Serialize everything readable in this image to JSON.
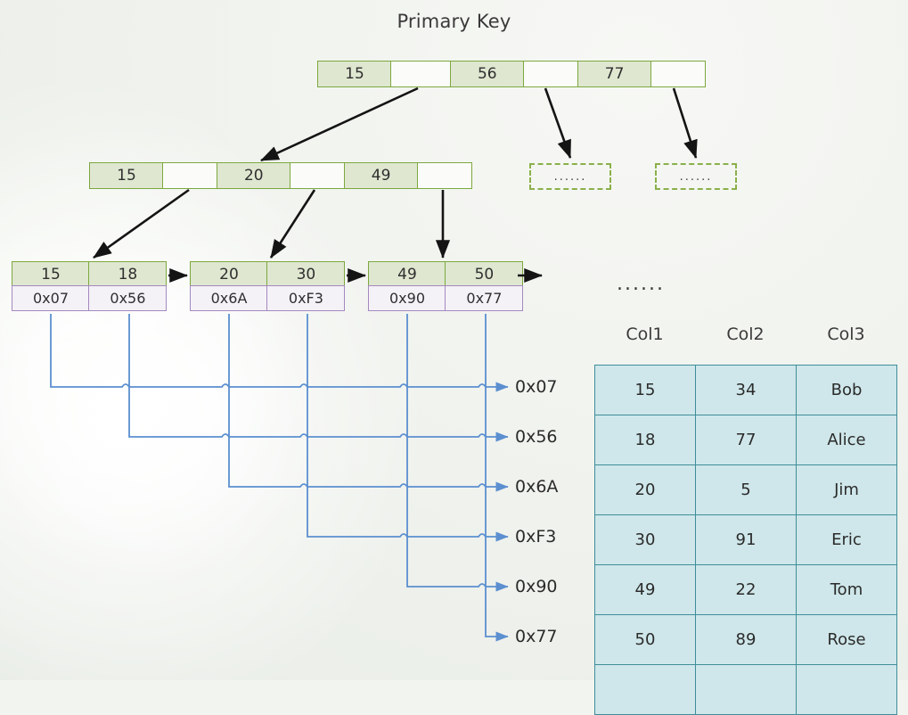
{
  "title": "Primary Key",
  "colors": {
    "node_fill": "#dfe7d0",
    "node_border": "#7ca83f",
    "pointer_fill": "#f4f1f7",
    "pointer_border": "#a489bf",
    "table_fill": "#cfe7ea",
    "table_border": "#3f8d99",
    "connector_blue": "#5b8fd0",
    "arrow_black": "#1a1a1a",
    "background": "#eef2ec"
  },
  "tree": {
    "root": {
      "cells": [
        {
          "value": "15",
          "empty": false
        },
        {
          "value": "",
          "empty": true
        },
        {
          "value": "56",
          "empty": false
        },
        {
          "value": "",
          "empty": true
        },
        {
          "value": "77",
          "empty": false
        },
        {
          "value": "",
          "empty": true
        }
      ]
    },
    "internal": {
      "cells": [
        {
          "value": "15",
          "empty": false
        },
        {
          "value": "",
          "empty": true
        },
        {
          "value": "20",
          "empty": false
        },
        {
          "value": "",
          "empty": true
        },
        {
          "value": "49",
          "empty": false
        },
        {
          "value": "",
          "empty": true
        }
      ]
    },
    "placeholders": [
      {
        "text": "......"
      },
      {
        "text": "......"
      }
    ],
    "leaves": [
      {
        "keys": [
          "15",
          "18"
        ],
        "pointers": [
          "0x07",
          "0x56"
        ]
      },
      {
        "keys": [
          "20",
          "30"
        ],
        "pointers": [
          "0x6A",
          "0xF3"
        ]
      },
      {
        "keys": [
          "49",
          "50"
        ],
        "pointers": [
          "0x90",
          "0x77"
        ]
      }
    ]
  },
  "addresses": [
    "0x07",
    "0x56",
    "0x6A",
    "0xF3",
    "0x90",
    "0x77"
  ],
  "table_ellipsis": "......",
  "table": {
    "headers": [
      "Col1",
      "Col2",
      "Col3"
    ],
    "rows": [
      [
        "15",
        "34",
        "Bob"
      ],
      [
        "18",
        "77",
        "Alice"
      ],
      [
        "20",
        "5",
        "Jim"
      ],
      [
        "30",
        "91",
        "Eric"
      ],
      [
        "49",
        "22",
        "Tom"
      ],
      [
        "50",
        "89",
        "Rose"
      ],
      [
        "",
        "",
        ""
      ]
    ]
  },
  "chart_data": {
    "type": "diagram",
    "title": "Primary Key",
    "description": "B+ tree index over a primary key column pointing into a heap table",
    "levels": [
      {
        "level": 0,
        "keys": [
          "15",
          "56",
          "77"
        ]
      },
      {
        "level": 1,
        "keys": [
          "15",
          "20",
          "49"
        ]
      },
      {
        "level": 2,
        "leaves": [
          [
            "15",
            "18"
          ],
          [
            "20",
            "30"
          ],
          [
            "49",
            "50"
          ]
        ]
      }
    ],
    "row_pointers": {
      "15": "0x07",
      "18": "0x56",
      "20": "0x6A",
      "30": "0xF3",
      "49": "0x90",
      "50": "0x77"
    },
    "table_rows": [
      {
        "Col1": "15",
        "Col2": "34",
        "Col3": "Bob"
      },
      {
        "Col1": "18",
        "Col2": "77",
        "Col3": "Alice"
      },
      {
        "Col1": "20",
        "Col2": "5",
        "Col3": "Jim"
      },
      {
        "Col1": "30",
        "Col2": "91",
        "Col3": "Eric"
      },
      {
        "Col1": "49",
        "Col2": "22",
        "Col3": "Tom"
      },
      {
        "Col1": "50",
        "Col2": "89",
        "Col3": "Rose"
      }
    ]
  }
}
